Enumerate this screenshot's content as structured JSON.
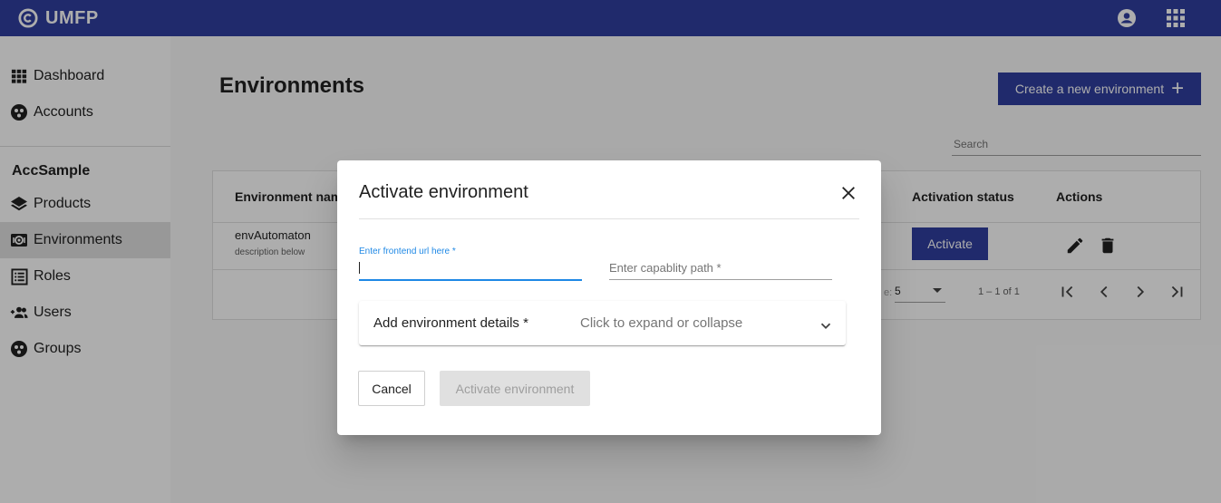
{
  "app": {
    "brand": "UMFP",
    "logo_icon": "cc-logo-icon",
    "account_icon": "account-circle-icon",
    "apps_icon": "apps-grid-icon"
  },
  "sidebar": {
    "top_items": [
      {
        "label": "Dashboard",
        "icon": "dashboard-grid-icon"
      },
      {
        "label": "Accounts",
        "icon": "accounts-icon"
      }
    ],
    "org_name": "AccSample",
    "org_items": [
      {
        "label": "Products",
        "icon": "layers-icon"
      },
      {
        "label": "Environments",
        "icon": "environment-icon",
        "active": true
      },
      {
        "label": "Roles",
        "icon": "list-icon"
      },
      {
        "label": "Users",
        "icon": "group-add-icon"
      },
      {
        "label": "Groups",
        "icon": "groups-icon"
      }
    ]
  },
  "main": {
    "title": "Environments",
    "create_button": "Create a new environment",
    "search_placeholder": "Search",
    "table": {
      "headers": {
        "name": "Environment name",
        "activation_status": "Activation status",
        "actions": "Actions"
      },
      "rows": [
        {
          "name": "envAutomaton",
          "description": "description below",
          "activate_label": "Activate"
        }
      ],
      "pagination": {
        "rows_label": "e:",
        "rows_per_page": "5",
        "range": "1 – 1 of 1"
      }
    }
  },
  "dialog": {
    "title": "Activate environment",
    "frontend_url_label": "Enter frontend url here *",
    "capability_path_placeholder": "Enter capablity path *",
    "expander_title": "Add environment details *",
    "expander_description": "Click to expand or collapse",
    "cancel_label": "Cancel",
    "submit_label": "Activate environment"
  },
  "colors": {
    "primary": "#303f9f",
    "focus": "#1e88e5",
    "disabled_bg": "#e0e0e0"
  }
}
